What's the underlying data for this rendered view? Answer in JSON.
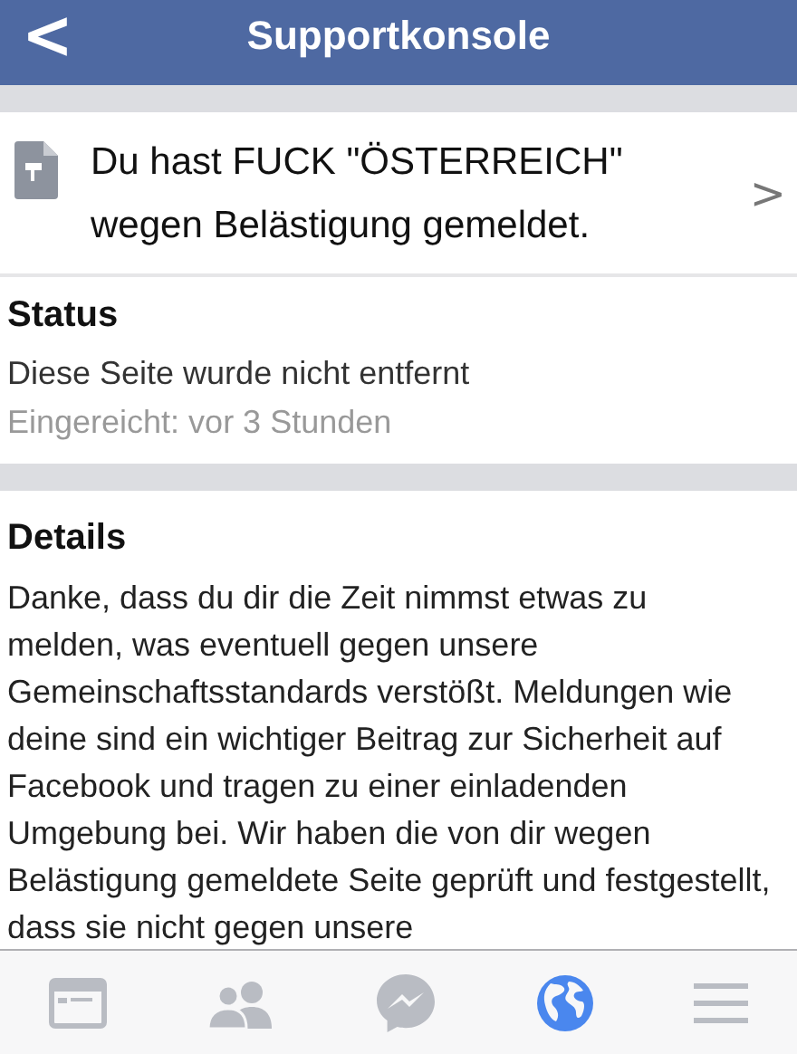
{
  "header": {
    "back": "<",
    "title": "Supportkonsole"
  },
  "report": {
    "text": "Du hast FUCK \"ÖSTERREICH\" wegen Belästigung gemeldet.",
    "chevron": ">"
  },
  "status": {
    "heading": "Status",
    "text": "Diese Seite wurde nicht entfernt",
    "submitted": "Eingereicht: vor 3 Stunden"
  },
  "details": {
    "heading": "Details",
    "text": "Danke, dass du dir die Zeit nimmst etwas zu melden, was eventuell gegen unsere Gemeinschaftsstandards verstößt. Meldungen wie deine sind ein wichtiger Beitrag zur Sicherheit auf Facebook und tragen zu einer einladenden Umgebung bei. Wir haben die von dir wegen Belästigung gemeldete Seite geprüft und festgestellt, dass sie nicht gegen unsere"
  },
  "tabs": [
    {
      "kind": "feed",
      "selected": false
    },
    {
      "kind": "friends",
      "selected": false
    },
    {
      "kind": "messenger",
      "selected": false
    },
    {
      "kind": "globe",
      "selected": true
    },
    {
      "kind": "menu",
      "selected": false
    }
  ]
}
